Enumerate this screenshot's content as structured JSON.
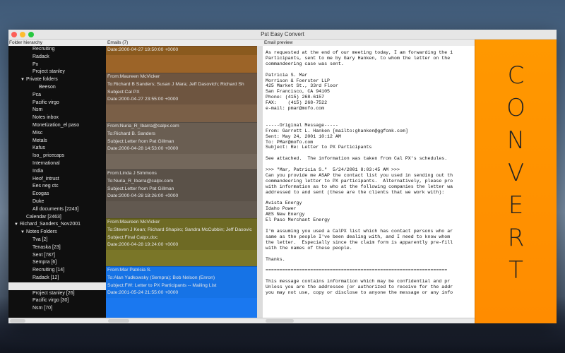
{
  "window": {
    "title": "Pst Easy Convert"
  },
  "headers": {
    "folders": "Folder hierarchy",
    "emails": "Emails (7)",
    "preview": "Email preview"
  },
  "folders": [
    {
      "label": "Recruiting",
      "indent": 2,
      "tri": ""
    },
    {
      "label": "Radack",
      "indent": 2,
      "tri": ""
    },
    {
      "label": "Px",
      "indent": 2,
      "tri": ""
    },
    {
      "label": "Project stanley",
      "indent": 2,
      "tri": ""
    },
    {
      "label": "Private folders",
      "indent": 1,
      "tri": "▼"
    },
    {
      "label": "Beeson",
      "indent": 3,
      "tri": ""
    },
    {
      "label": "Pca",
      "indent": 2,
      "tri": ""
    },
    {
      "label": "Pacific virgo",
      "indent": 2,
      "tri": ""
    },
    {
      "label": "Nsm",
      "indent": 2,
      "tri": ""
    },
    {
      "label": "Notes inbox",
      "indent": 2,
      "tri": ""
    },
    {
      "label": "Monetization_el paso",
      "indent": 2,
      "tri": ""
    },
    {
      "label": "Misc",
      "indent": 2,
      "tri": ""
    },
    {
      "label": "Metals",
      "indent": 2,
      "tri": ""
    },
    {
      "label": "Kafus",
      "indent": 2,
      "tri": ""
    },
    {
      "label": "Iso_ pricecaps",
      "indent": 2,
      "tri": ""
    },
    {
      "label": "International",
      "indent": 2,
      "tri": ""
    },
    {
      "label": "India",
      "indent": 2,
      "tri": ""
    },
    {
      "label": "Heof_intrust",
      "indent": 2,
      "tri": ""
    },
    {
      "label": "Ees neg ctc",
      "indent": 2,
      "tri": ""
    },
    {
      "label": "Ecogas",
      "indent": 2,
      "tri": ""
    },
    {
      "label": "Duke",
      "indent": 2,
      "tri": ""
    },
    {
      "label": "All documents [2243]",
      "indent": 2,
      "tri": ""
    },
    {
      "label": "Calendar [2463]",
      "indent": 1,
      "tri": ""
    },
    {
      "label": "Richard_Sanders_Nov2001",
      "indent": 0,
      "tri": "▼"
    },
    {
      "label": "Notes Folders",
      "indent": 1,
      "tri": "▼"
    },
    {
      "label": "Tva [2]",
      "indent": 2,
      "tri": ""
    },
    {
      "label": "Tenaska [23]",
      "indent": 2,
      "tri": ""
    },
    {
      "label": "Sent [787]",
      "indent": 2,
      "tri": ""
    },
    {
      "label": "Sempra [6]",
      "indent": 2,
      "tri": ""
    },
    {
      "label": "Recruiting [14]",
      "indent": 2,
      "tri": ""
    },
    {
      "label": "Radack [12]",
      "indent": 2,
      "tri": ""
    },
    {
      "label": "",
      "indent": 2,
      "tri": "",
      "selected": true
    },
    {
      "label": "Project stanley [26]",
      "indent": 2,
      "tri": ""
    },
    {
      "label": "Pacific virgo [30]",
      "indent": 2,
      "tri": ""
    },
    {
      "label": "Nsm [70]",
      "indent": 2,
      "tri": ""
    }
  ],
  "emails": [
    {
      "from": "",
      "to": "",
      "subject": "",
      "date": "Date:2000-04-27 19:50:00 +0000",
      "color": "#8a5a1e",
      "fill": "#9c6428",
      "height": 38,
      "partial": true
    },
    {
      "from": "From:Maureen McVicker",
      "to": "To:Richard B Sanders; Susan J Mara; Jeff Dasovich; Richard Sh",
      "subject": "Subject:Cal PX",
      "date": "Date:2000-04-27 23:55:00 +0000",
      "color": "#6e5540",
      "fill": "#7a5f47",
      "height": 70
    },
    {
      "from": "From:Nuria_R_Ibarra@calpx.com",
      "to": "To:Richard B. Sanders",
      "subject": "Subject:Letter from Pat Gillman",
      "date": "Date:2000-04-28 14:53:00 +0000",
      "color": "#6a5e52",
      "fill": "#73675b",
      "height": 67
    },
    {
      "from": "From:Linda J Simmons",
      "to": "To:Nuria_R_Ibarra@calpx.com",
      "subject": "Subject:Letter from Pat Gillman",
      "date": "Date:2000-04-28 18:26:00 +0000",
      "color": "#5a5148",
      "fill": "#625950",
      "height": 69
    },
    {
      "from": "From:Maureen McVicker",
      "to": "To:Steven J Kean; Richard Shapiro; Sandra McCubbin; Jeff Dasovic",
      "subject": "Subject:Final Calpx.doc",
      "date": "Date:2000-04-28 19:24:00 +0000",
      "color": "#6e6a24",
      "fill": "#7a7628",
      "height": 68
    },
    {
      "from": "From:Mar  Patricia S.",
      "to": "To:Alan Yudkowsky (Sempra); Bob Nelson (Enron)",
      "subject": "Subject:FW: Letter to PX Participants -- Mailing List",
      "date": "Date:2001-05-24 21:55:00 +0000",
      "color": "#1673e6",
      "fill": "#1a78f0",
      "height": 73
    }
  ],
  "preview": {
    "body": "As requested at the end of our meeting today, I am forwarding the 1\nParticipants, sent to me by Gary Hanken, to whom the letter on the\ncommandeering case was sent.\n\nPatricia S. Mar\nMorrison & Foerster LLP\n425 Market St., 33rd Floor\nSan Francisco, CA 94105\nPhone: (415) 268-6157\nFAX:    (415) 268-7522\ne-mail: pmar@mofo.com\n\n\n-----Original Message-----\nFrom: Garrett L. Hanken [mailto:ghanken@ggfcmk.com]\nSent: May 24, 2001 10:12 AM\nTo: PMar@mofo.com\nSubject: Re: Letter to PX Participants\n\nSee attached.  The information was taken from Cal PX's schedules.\n\n>>> \"Mar, Patricia S.\"  5/24/2001 8:03:45 AM >>>\nCan you provide me ASAP the contact list you used in sending out th\ncommandeering letter to PX participants.  Alternatively, please pro\nwith information as to who at the following companies the letter wa\naddressed to and sent (these are the clients that we work with):\n\nAvista Energy\nIdaho Power\nAES New Energy\nEl Paso Merchant Energy\n\nI'm assuming you used a CalPX list which has contact persons who ar\nsame as the people I've been dealing with, and I need to know whom\nthe letter.  Especially since the claim form is apparently pre-fill\nwith the names of these people.\n\nThanks.\n\n=================================================================\n\nThis message contains information which may be confidential and pr\nUnless you are the addressee (or authorized to receive for the addr\nyou may not use, copy or disclose to anyone the message or any info"
  },
  "convert": {
    "label": "CONVERT",
    "accent": "#ff9800"
  }
}
